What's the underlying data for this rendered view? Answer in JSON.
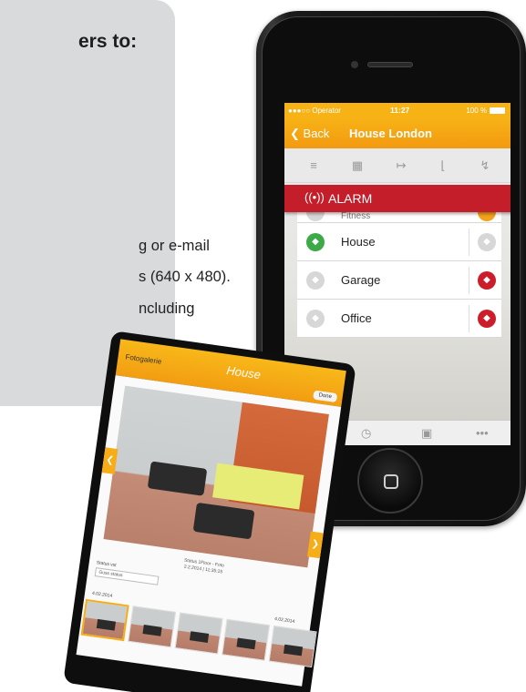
{
  "info_panel": {
    "heading": "ers to:",
    "lines": [
      "g or e-mail",
      "s (640 x 480).",
      "ncluding"
    ]
  },
  "phone": {
    "status_bar": {
      "carrier": "●●●○○ Operator",
      "time": "11:27",
      "battery": "100 %"
    },
    "nav": {
      "back_label": "Back",
      "title": "House London"
    },
    "alarm_label": "ALARM",
    "partial_row_label": "Fitness",
    "locks": [
      {
        "name": "House",
        "left_state": "unlocked",
        "right_state": "neutral"
      },
      {
        "name": "Garage",
        "left_state": "neutral",
        "right_state": "locked"
      },
      {
        "name": "Office",
        "left_state": "neutral",
        "right_state": "locked"
      }
    ],
    "bottom_more": "•••"
  },
  "tablet": {
    "gallery_label": "Fotogalerie",
    "title": "House",
    "done_label": "Done",
    "caption_line1": "Status 1Floor - Foto",
    "caption_line2": "2.2.2014 | 11:35:15",
    "status_label": "Status vst",
    "select_value": "Guss status",
    "dates": [
      "4.02.2014",
      "4.02.2014"
    ]
  },
  "colors": {
    "accent_orange": "#f7b316",
    "alarm_red": "#c41e2b",
    "unlocked_green": "#3daa47",
    "locked_red": "#cc1e2a",
    "panel_gray": "#d9dadb"
  }
}
